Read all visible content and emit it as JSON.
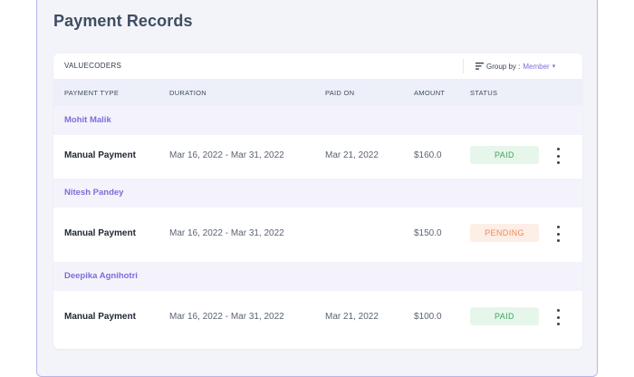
{
  "page": {
    "title": "Payment Records"
  },
  "toolbar": {
    "org": "VALUECODERS",
    "group_by_label": "Group by :",
    "group_by_value": "Member",
    "sort_icon": "sort-lines-icon",
    "caret_icon": "caret-down-icon"
  },
  "columns": [
    "PAYMENT TYPE",
    "DURATION",
    "PAID ON",
    "AMOUNT",
    "STATUS"
  ],
  "groups": [
    {
      "member": "Mohit Malik",
      "payment_type": "Manual Payment",
      "duration": "Mar 16, 2022 - Mar 31, 2022",
      "paid_on": "Mar 21, 2022",
      "amount": "$160.0",
      "status": "PAID"
    },
    {
      "member": "Nitesh Pandey",
      "payment_type": "Manual Payment",
      "duration": "Mar 16, 2022 - Mar 31, 2022",
      "paid_on": "",
      "amount": "$150.0",
      "status": "PENDING"
    },
    {
      "member": "Deepika Agnihotri",
      "payment_type": "Manual Payment",
      "duration": "Mar 16, 2022 - Mar 31, 2022",
      "paid_on": "Mar 21, 2022",
      "amount": "$100.0",
      "status": "PAID"
    }
  ],
  "colors": {
    "accent": "#7a6fd8",
    "paid_text": "#3ea65a",
    "paid_bg": "#e6f6ea",
    "pending_text": "#f0895a",
    "pending_bg": "#fdeee6",
    "frame_border": "#b9b3ea"
  }
}
